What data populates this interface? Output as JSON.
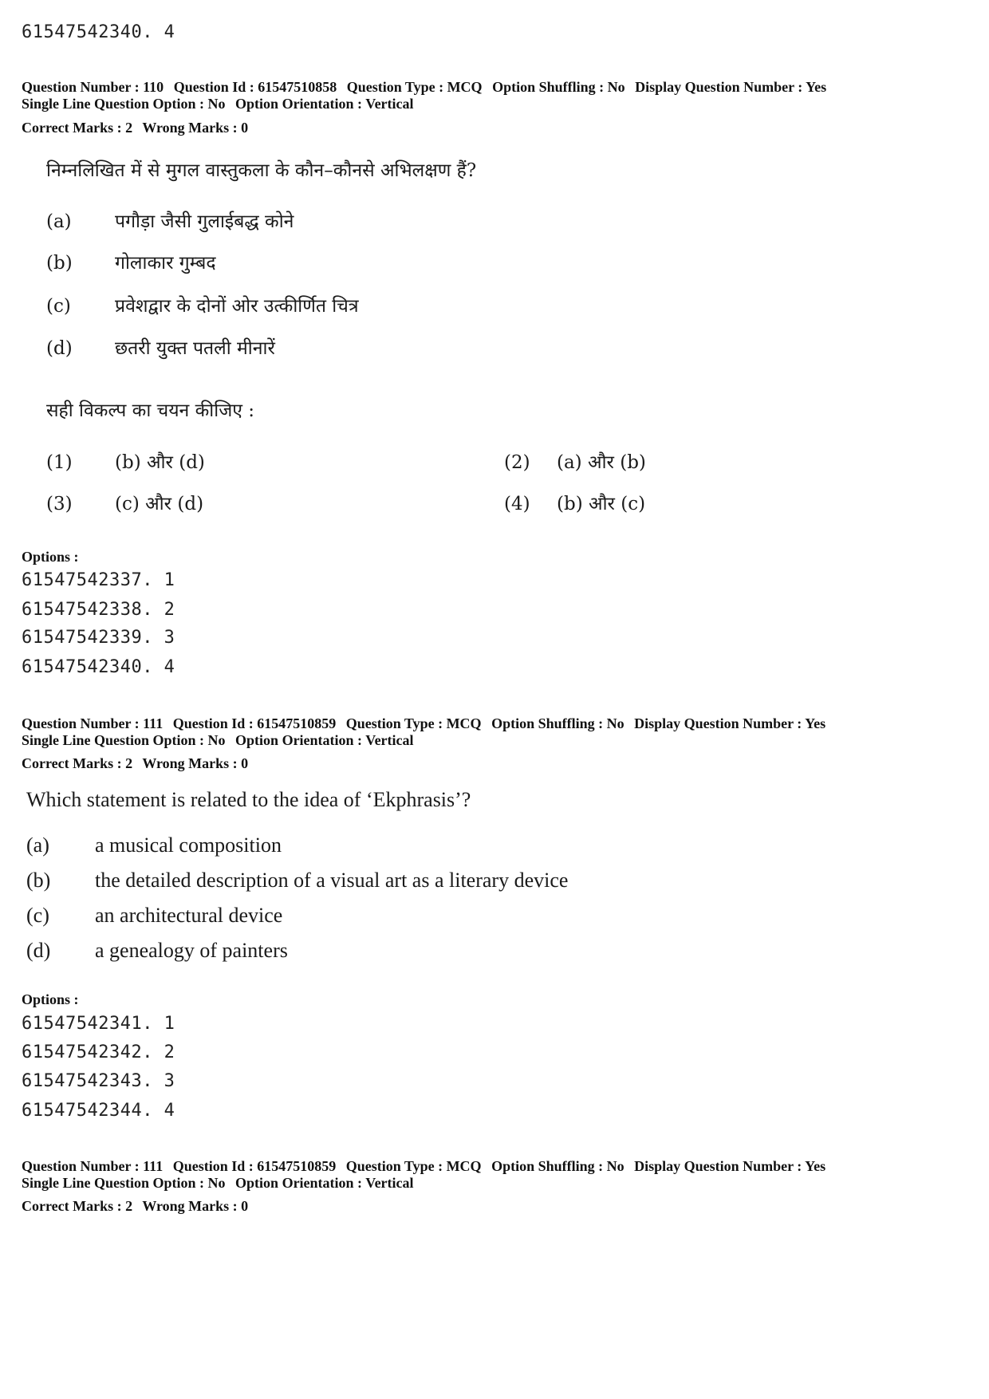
{
  "top_option_line": "61547542340. 4",
  "questions": [
    {
      "header": {
        "question_number": "Question Number : 110",
        "question_id": "Question Id : 61547510858",
        "question_type": "Question Type : MCQ",
        "option_shuffling": "Option Shuffling : No",
        "display_question_number": "Display Question Number : Yes",
        "single_line": "Single Line Question Option : No",
        "orientation": "Option Orientation : Vertical",
        "correct_marks": "Correct Marks : 2",
        "wrong_marks": "Wrong Marks : 0"
      },
      "text": "निम्नलिखित में से मुगल वास्तुकला के कौन–कौनसे अभिलक्षण हैं?",
      "statements": [
        {
          "label": "(a)",
          "text": "पगौड़ा जैसी गुलाईबद्ध कोने"
        },
        {
          "label": "(b)",
          "text": "गोलाकार गुम्बद"
        },
        {
          "label": "(c)",
          "text": "प्रवेशद्वार के दोनों ओर उत्कीर्णित चित्र"
        },
        {
          "label": "(d)",
          "text": "छतरी युक्त पतली मीनारें"
        }
      ],
      "instruction": "सही विकल्प का चयन कीजिए :",
      "choices": [
        {
          "num": "(1)",
          "text": "(b) और (d)"
        },
        {
          "num": "(2)",
          "text": "(a) और (b)"
        },
        {
          "num": "(3)",
          "text": "(c) और (d)"
        },
        {
          "num": "(4)",
          "text": "(b) और (c)"
        }
      ],
      "options_label": "Options :",
      "options": [
        "61547542337. 1",
        "61547542338. 2",
        "61547542339. 3",
        "61547542340. 4"
      ]
    },
    {
      "header": {
        "question_number": "Question Number : 111",
        "question_id": "Question Id : 61547510859",
        "question_type": "Question Type : MCQ",
        "option_shuffling": "Option Shuffling : No",
        "display_question_number": "Display Question Number : Yes",
        "single_line": "Single Line Question Option : No",
        "orientation": "Option Orientation : Vertical",
        "correct_marks": "Correct Marks : 2",
        "wrong_marks": "Wrong Marks : 0"
      },
      "text": "Which statement is related to the idea of ‘Ekphrasis’?",
      "statements": [
        {
          "label": "(a)",
          "text": "a musical composition"
        },
        {
          "label": "(b)",
          "text": "the detailed description of a visual art as a literary device"
        },
        {
          "label": "(c)",
          "text": "an architectural device"
        },
        {
          "label": "(d)",
          "text": "a genealogy of painters"
        }
      ],
      "options_label": "Options :",
      "options": [
        "61547542341. 1",
        "61547542342. 2",
        "61547542343. 3",
        "61547542344. 4"
      ]
    },
    {
      "header": {
        "question_number": "Question Number : 111",
        "question_id": "Question Id : 61547510859",
        "question_type": "Question Type : MCQ",
        "option_shuffling": "Option Shuffling : No",
        "display_question_number": "Display Question Number : Yes",
        "single_line": "Single Line Question Option : No",
        "orientation": "Option Orientation : Vertical",
        "correct_marks": "Correct Marks : 2",
        "wrong_marks": "Wrong Marks : 0"
      }
    }
  ]
}
